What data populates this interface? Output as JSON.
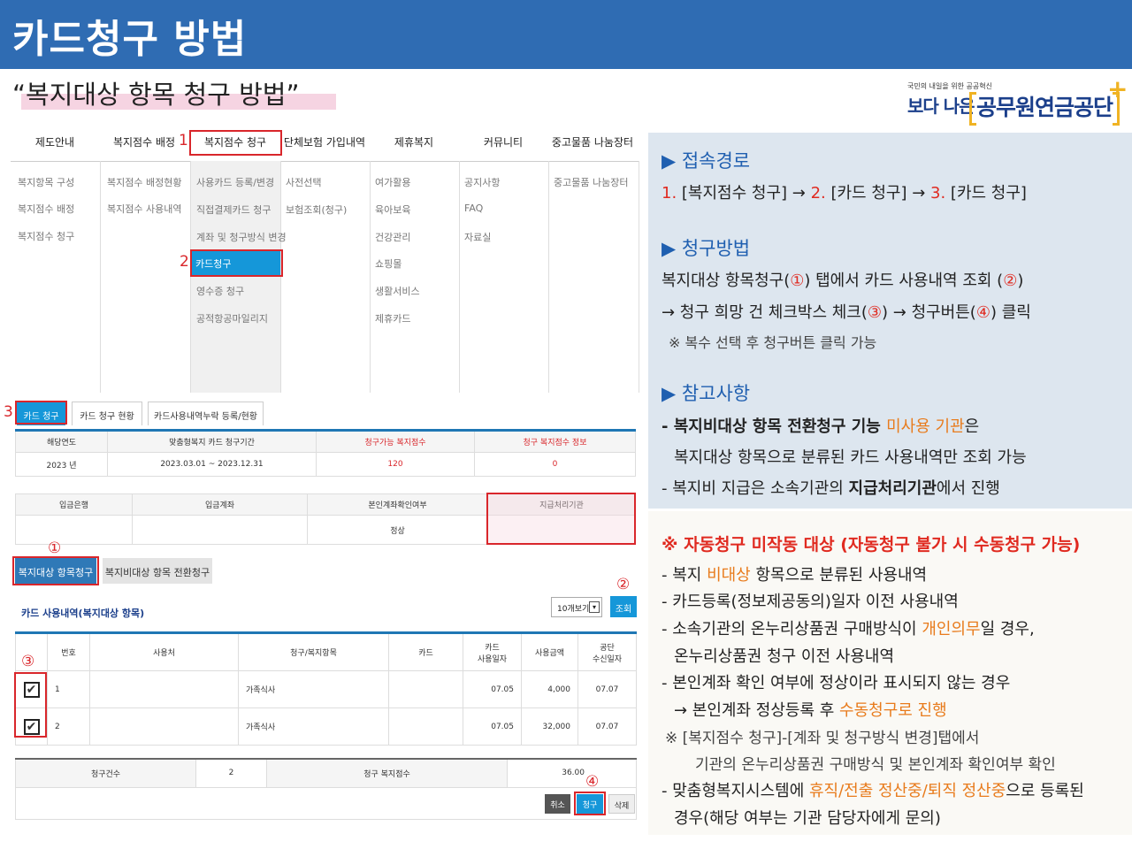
{
  "header": {
    "title": "카드청구 방법"
  },
  "subtitle": "“복지대상 항목 청구 방법”",
  "logo": {
    "tagline": "국민의 내일을 위한 공공혁신",
    "boda": "보다 나은",
    "org": "공무원연금공단",
    "plus": "+"
  },
  "nav": {
    "items": [
      "제도안내",
      "복지점수 배정",
      "복지점수 청구",
      "단체보험 가입내역",
      "제휴복지",
      "커뮤니티",
      "중고물품 나눔장터"
    ],
    "marker1": "1",
    "marker2": "2",
    "marker3": "3",
    "col0": [
      "복지항목 구성",
      "복지점수 배정",
      "복지점수 청구"
    ],
    "col1": [
      "복지점수 배정현황",
      "복지점수 사용내역"
    ],
    "col2": [
      "사용카드 등록/변경",
      "직접결제카드 청구",
      "계좌 및 청구방식 변경",
      "카드청구",
      "영수증 청구",
      "공적항공마일리지"
    ],
    "col3": [
      "사전선택",
      "보험조회(청구)"
    ],
    "col4": [
      "여가활용",
      "육아보육",
      "건강관리",
      "쇼핑몰",
      "생활서비스",
      "제휴카드"
    ],
    "col5": [
      "공지사항",
      "FAQ",
      "자료실"
    ],
    "col6": [
      "중고물품 나눔장터"
    ]
  },
  "tabs": [
    "카드 청구",
    "카드 청구 현황",
    "카드사용내역누락 등록/현황"
  ],
  "summary": {
    "headers": [
      "해당연도",
      "맞춤형복지 카드 청구기간",
      "청구가능 복지점수",
      "청구 복지점수 정보"
    ],
    "row": [
      "2023 년",
      "2023.03.01 ~ 2023.12.31",
      "120",
      "0"
    ]
  },
  "account": {
    "headers": [
      "입금은행",
      "입금계좌",
      "본인계좌확인여부",
      "지급처리기관"
    ],
    "row": [
      "",
      "",
      "정상",
      ""
    ]
  },
  "claim_tabs": {
    "active": "복지대상 항목청구",
    "other": "복지비대상 항목 전환청구",
    "circle1": "①",
    "circle2": "②",
    "circle3": "③",
    "circle4": "④"
  },
  "list": {
    "title": "카드 사용내역(복지대상 항목)",
    "select": "10개보기",
    "search_btn": "조회",
    "headers": [
      "번호",
      "사용처",
      "청구/복지항목",
      "카드",
      "카드\n사용일자",
      "사용금액",
      "공단\n수신일자"
    ],
    "rows": [
      {
        "check": "✔",
        "no": "1",
        "place": "",
        "item": "가족식사",
        "card": "",
        "date": "07.05",
        "amount": "4,000",
        "recv": "07.07"
      },
      {
        "check": "✔",
        "no": "2",
        "place": "",
        "item": "가족식사",
        "card": "",
        "date": "07.05",
        "amount": "32,000",
        "recv": "07.07"
      }
    ]
  },
  "totals": {
    "count_label": "청구건수",
    "count": "2",
    "points_label": "청구 복지점수",
    "points": "36.00"
  },
  "actions": {
    "cancel": "취소",
    "claim": "청구",
    "delete": "삭제"
  },
  "info": {
    "route_head": "▶ 접속경로",
    "route_1n": "1.",
    "route_1": " [복지점수 청구] → ",
    "route_2n": "2.",
    "route_2": " [카드 청구] → ",
    "route_3n": "3.",
    "route_3": " [카드 청구]",
    "method_head": "▶ 청구방법",
    "method_l1a": "복지대상 항목청구(",
    "method_c1": "①",
    "method_l1b": ") 탭에서 카드 사용내역 조회 (",
    "method_c2": "②",
    "method_l1c": ")",
    "method_l2a": "→ 청구 희망 건 체크박스 체크(",
    "method_c3": "③",
    "method_l2b": ") → 청구버튼(",
    "method_c4": "④",
    "method_l2c": ") 클릭",
    "method_note": "※ 복수 선택 후 청구버튼 클릭 가능",
    "ref_head": "▶ 참고사항",
    "ref_l1a": "- 복지비대상 항목 전환청구 기능 ",
    "ref_l1b": "미사용 기관",
    "ref_l1c": "은",
    "ref_l2": "복지대상 항목으로 분류된 카드 사용내역만 조회 가능",
    "ref_l3a": "- 복지비 지급은 소속기관의 ",
    "ref_l3b": "지급처리기관",
    "ref_l3c": "에서 진행"
  },
  "notes": {
    "warn": "※ 자동청구 미작동 대상 (자동청구 불가 시 수동청구 가능)",
    "n1a": "- 복지 ",
    "n1b": "비대상",
    "n1c": " 항목으로 분류된 사용내역",
    "n2": "- 카드등록(정보제공동의)일자 이전 사용내역",
    "n3a": "- 소속기관의 온누리상품권 구매방식이 ",
    "n3b": "개인의무",
    "n3c": "일 경우,",
    "n4": "온누리상품권 청구 이전 사용내역",
    "n5": "- 본인계좌 확인 여부에 정상이라 표시되지 않는 경우",
    "n6a": "→ 본인계좌 정상등록 후 ",
    "n6b": "수동청구로 진행",
    "n7": "※ [복지점수 청구]-[계좌 및 청구방식 변경]탭에서",
    "n8": "기관의 온누리상품권 구매방식 및 본인계좌 확인여부 확인",
    "n9a": "- 맞춤형복지시스템에 ",
    "n9b": "휴직/전출 정산중/퇴직 정산중",
    "n9c": "으로 등록된",
    "n10": "경우(해당 여부는 기관 담당자에게 문의)"
  }
}
